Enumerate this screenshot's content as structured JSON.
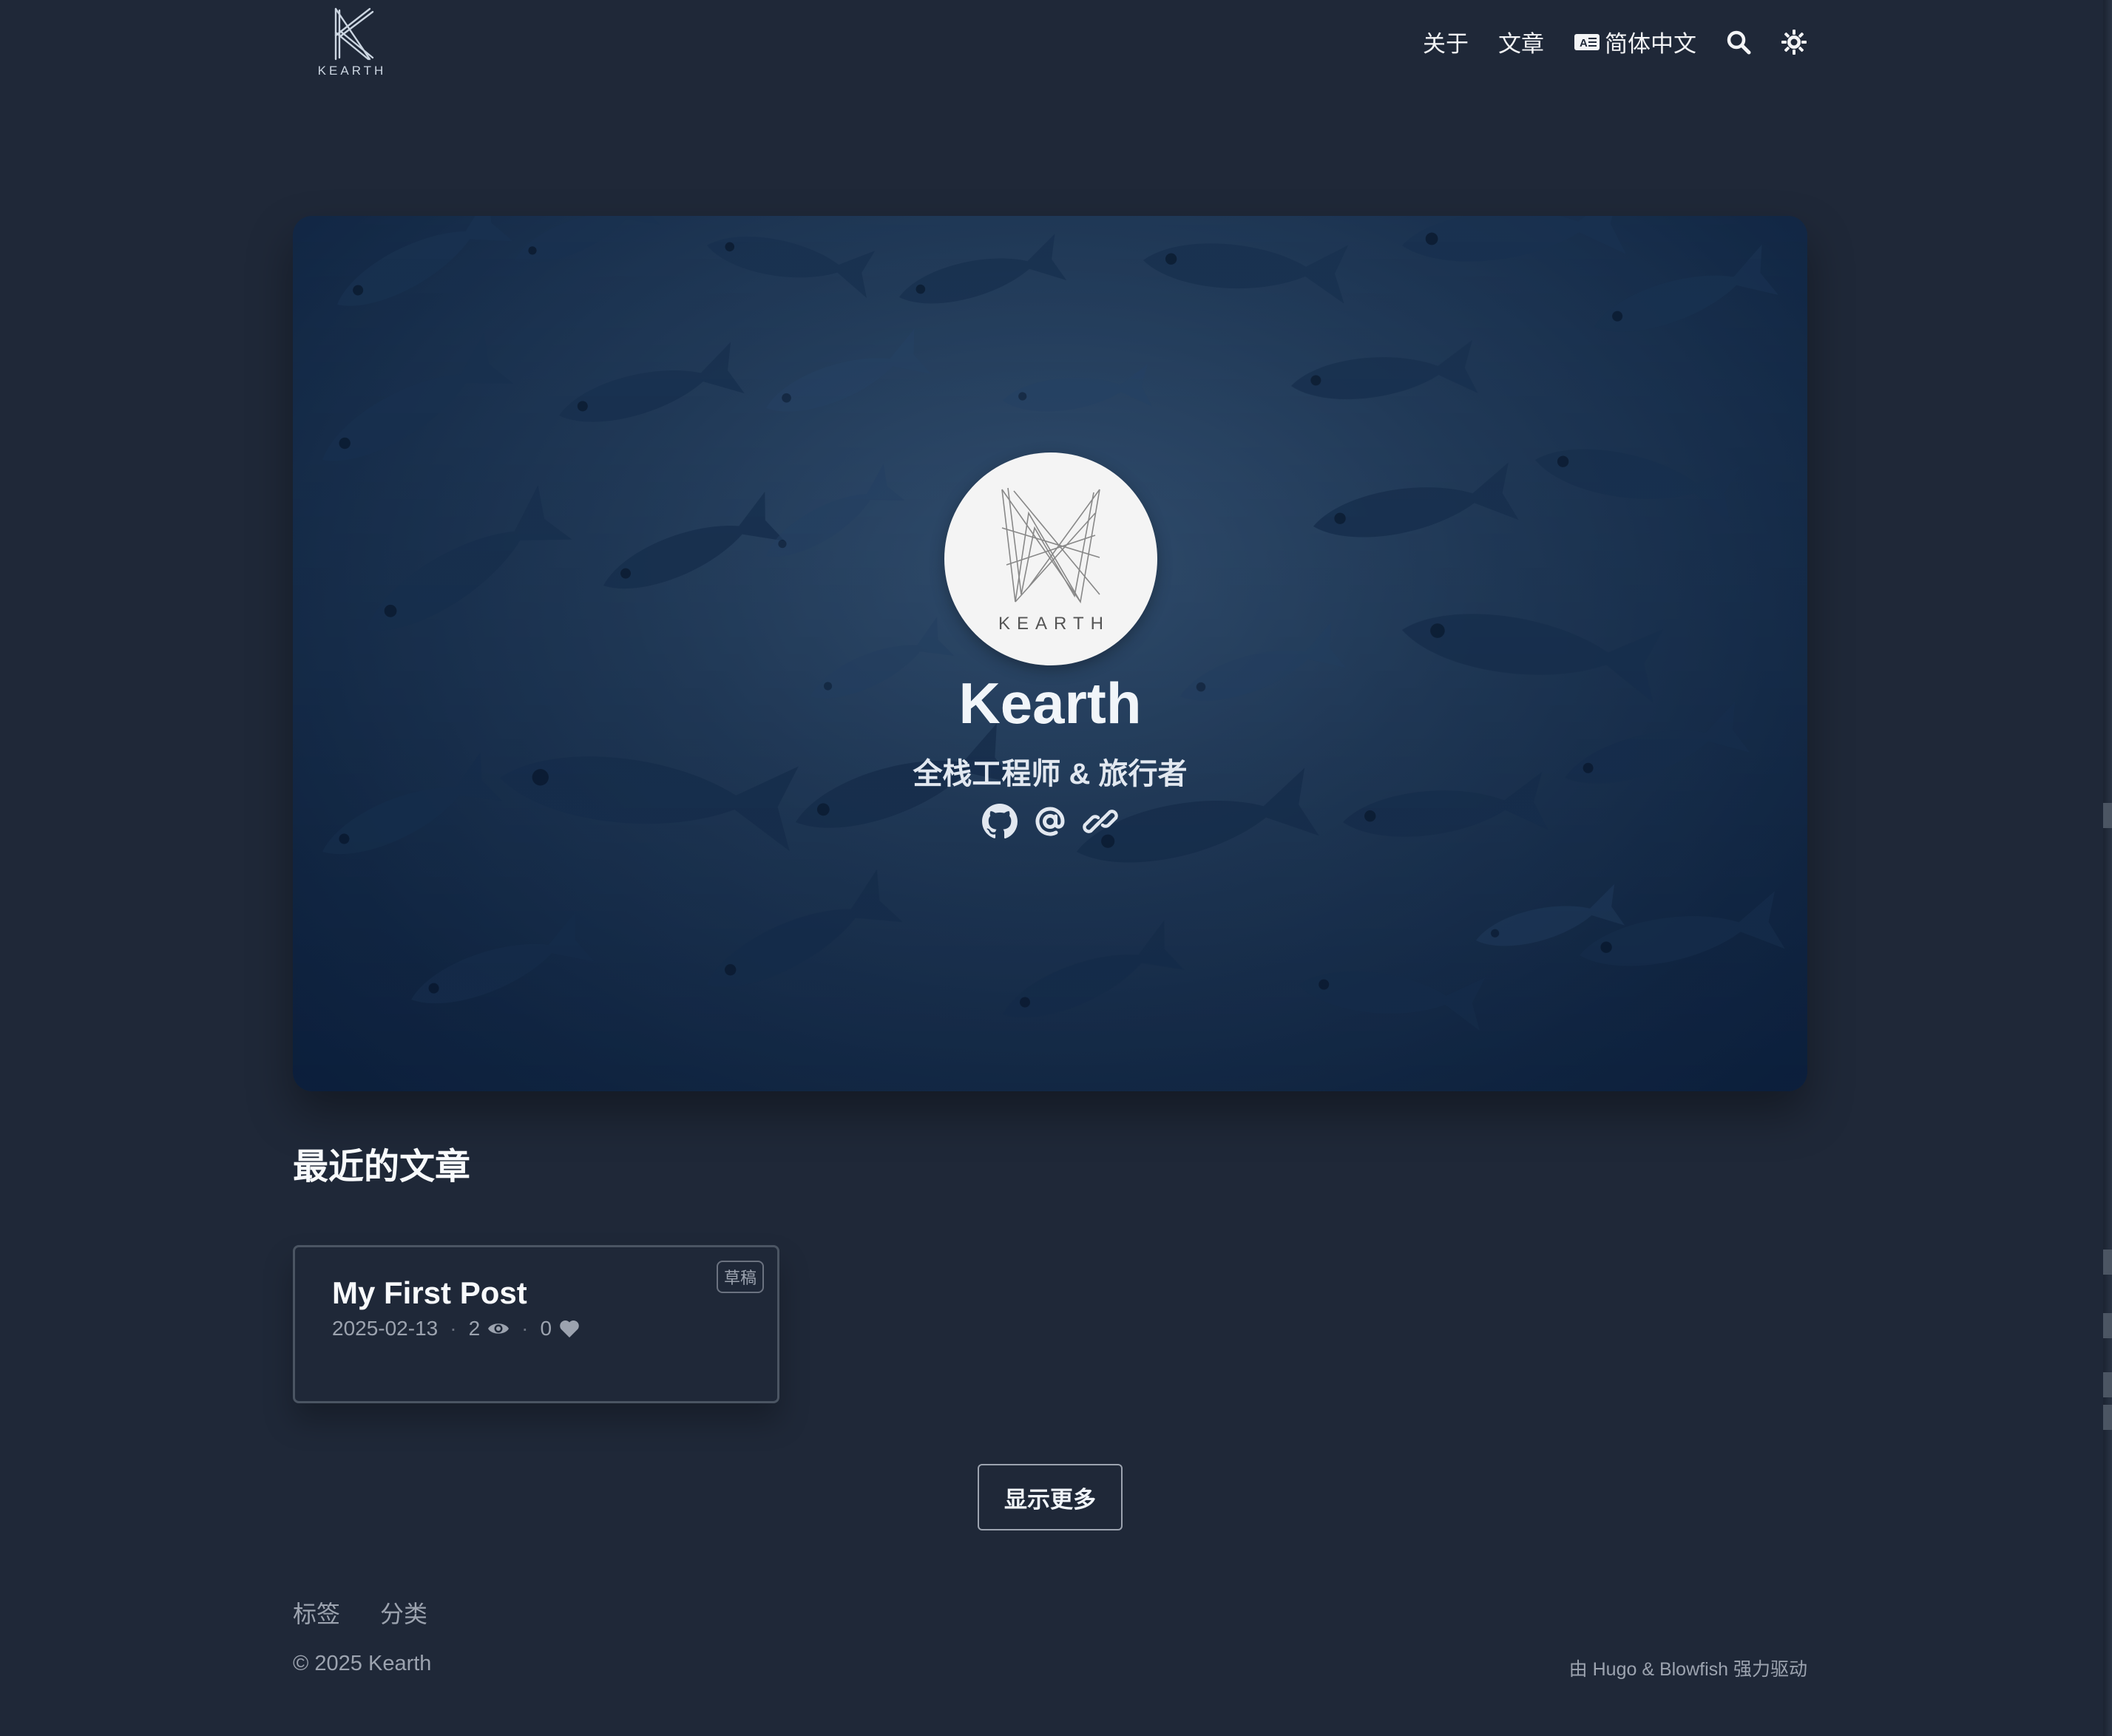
{
  "header": {
    "logo_text": "KEARTH",
    "nav": {
      "about": "关于",
      "posts": "文章",
      "language": "简体中文"
    },
    "icons": [
      "translate-icon",
      "search-icon",
      "theme-toggle-icon"
    ]
  },
  "hero": {
    "avatar_text": "KEARTH",
    "name": "Kearth",
    "tagline": "全栈工程师 & 旅行者",
    "links": [
      "github-icon",
      "email-icon",
      "link-icon"
    ]
  },
  "recent": {
    "title": "最近的文章",
    "posts": [
      {
        "title": "My First Post",
        "date": "2025-02-13",
        "views": "2",
        "likes": "0",
        "badge": "草稿"
      }
    ],
    "more_label": "显示更多"
  },
  "footer": {
    "links": [
      "标签",
      "分类"
    ],
    "copyright": "© 2025 Kearth",
    "powered_by": "由 Hugo & Blowfish 强力驱动"
  },
  "colors": {
    "background": "#1f2838",
    "hero_dark": "#0d2241",
    "text": "#f1f5f9",
    "muted": "#9ca3af"
  }
}
